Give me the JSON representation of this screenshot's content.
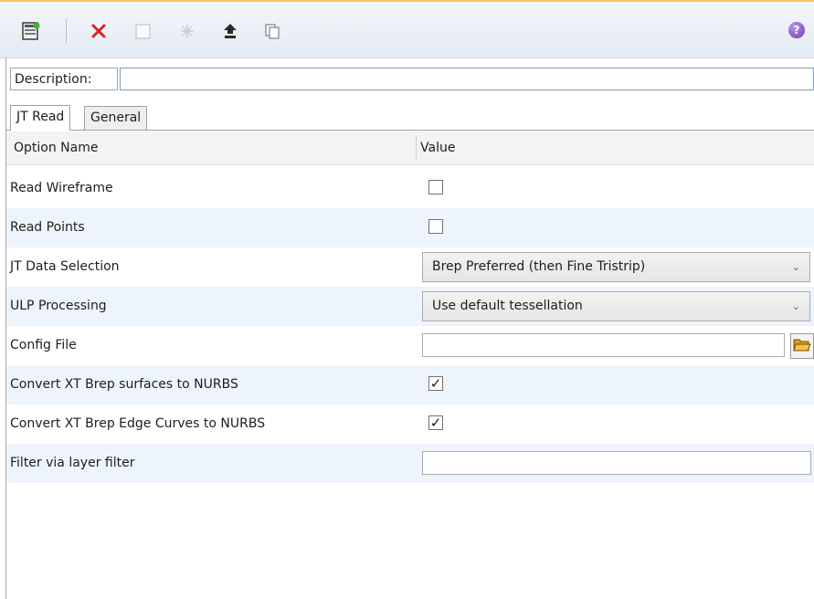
{
  "toolbar": {
    "buttons": [
      {
        "name": "new-option-set-icon"
      },
      {
        "name": "delete-icon"
      },
      {
        "name": "blank-icon"
      },
      {
        "name": "asterisk-icon"
      },
      {
        "name": "upload-icon"
      },
      {
        "name": "copy-icon"
      }
    ],
    "help_icon": "?"
  },
  "description": {
    "label": "Description:",
    "value": ""
  },
  "tabs": [
    {
      "label": "JT Read",
      "active": true
    },
    {
      "label": "General",
      "active": false
    }
  ],
  "table": {
    "headers": {
      "option": "Option Name",
      "value": "Value"
    },
    "rows": [
      {
        "label": "Read Wireframe",
        "type": "checkbox",
        "checked": false,
        "mark": ""
      },
      {
        "label": "Read Points",
        "type": "checkbox",
        "checked": false,
        "mark": ""
      },
      {
        "label": "JT Data Selection",
        "type": "dropdown",
        "value": "Brep Preferred (then Fine Tristrip)"
      },
      {
        "label": "ULP Processing",
        "type": "dropdown",
        "value": "Use default tessellation"
      },
      {
        "label": "Config File",
        "type": "file",
        "value": ""
      },
      {
        "label": "Convert XT Brep surfaces to NURBS",
        "type": "checkbox",
        "checked": true,
        "mark": "✓"
      },
      {
        "label": "Convert XT Brep Edge Curves to NURBS",
        "type": "checkbox",
        "checked": true,
        "mark": "✓"
      },
      {
        "label": "Filter via layer filter",
        "type": "text",
        "value": ""
      }
    ]
  },
  "colors": {
    "accent_line": "#f6c56a",
    "alt_row": "#eef4fb",
    "delete_red": "#e02020"
  }
}
